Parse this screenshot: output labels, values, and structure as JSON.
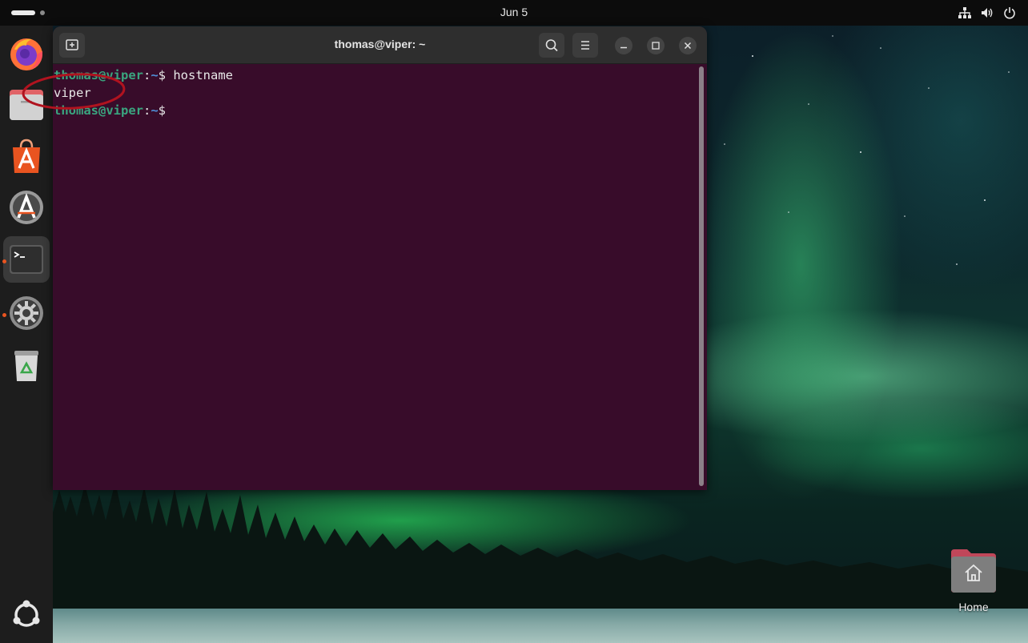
{
  "topbar": {
    "clock": "Jun 5",
    "tray_icons": [
      "network-icon",
      "volume-icon",
      "power-icon"
    ]
  },
  "dock": {
    "apps": [
      {
        "name": "Firefox",
        "icon": "firefox-icon",
        "running": false
      },
      {
        "name": "Files",
        "icon": "files-icon",
        "running": false
      },
      {
        "name": "App Center",
        "icon": "app-center-icon",
        "running": false
      },
      {
        "name": "Software Updater",
        "icon": "software-updater-icon",
        "running": false
      },
      {
        "name": "Terminal",
        "icon": "terminal-icon",
        "running": true,
        "active": true
      },
      {
        "name": "Settings",
        "icon": "settings-icon",
        "running": true
      },
      {
        "name": "Trash",
        "icon": "trash-icon",
        "running": false
      }
    ],
    "show_apps_icon": "ubuntu-logo-icon"
  },
  "terminal": {
    "title": "thomas@viper: ~",
    "lines": [
      {
        "user": "thomas@viper",
        "path": "~",
        "command": " hostname"
      },
      {
        "output": "viper"
      },
      {
        "user": "thomas@viper",
        "path": "~",
        "command": ""
      }
    ],
    "annotation_color": "#b0131f"
  },
  "desktop": {
    "home_label": "Home"
  },
  "colors": {
    "terminal_bg": "#380c2a",
    "prompt_user": "#3aa57f",
    "prompt_path": "#4f8fd8",
    "accent": "#e95420"
  }
}
